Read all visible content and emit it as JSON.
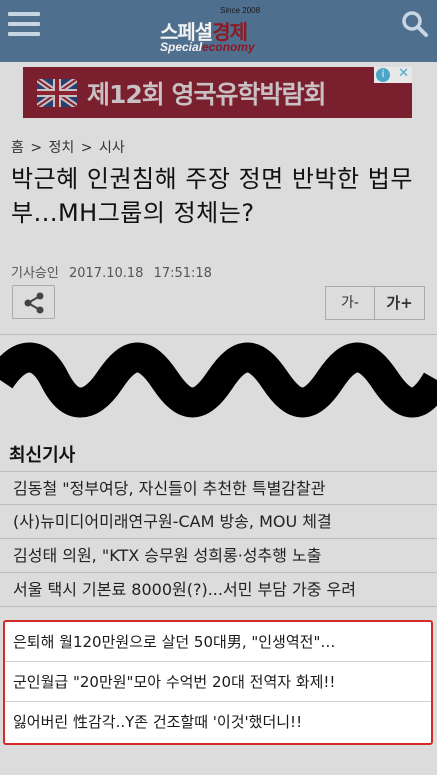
{
  "header": {
    "logo_since": "Since 2008",
    "logo_main_a": "스페셜",
    "logo_main_b": "경제",
    "logo_sub_a": "Special",
    "logo_sub_b": "economy",
    "background": "#4f6f8f"
  },
  "ad": {
    "text": "제12회 영국유학박람회",
    "info_symbol": "i",
    "close_symbol": "✕",
    "background": "#7a1f2d"
  },
  "breadcrumb": [
    "홈",
    ">",
    "정치",
    ">",
    "시사"
  ],
  "article": {
    "title": "박근혜 인권침해 주장 정면 반박한 법무부...MH그룹의 정체는?",
    "meta_label": "기사승인",
    "date": "2017.10.18",
    "time": "17:51:18"
  },
  "toolbar": {
    "font_minus": "가-",
    "font_plus": "가+"
  },
  "latest": {
    "title": "최신기사",
    "items": [
      "김동철 \"정부여당, 자신들이 추천한 특별감찰관",
      "(사)뉴미디어미래연구원-CAM 방송, MOU 체결",
      "김성태 의원, \"KTX 승무원 성희롱·성추행 노출",
      "서울 택시 기본료 8000원(?)...서민 부담 가중 우려"
    ]
  },
  "highlight": {
    "border_color": "#d42a2a",
    "items": [
      "은퇴해 월120만원으로 살던 50대男, \"인생역전\"…",
      "군인월급 \"20만원\"모아 수억번 20대 전역자 화제!!",
      "잃어버린 性감각..Y존 건조할때 '이것'했더니!!"
    ]
  }
}
